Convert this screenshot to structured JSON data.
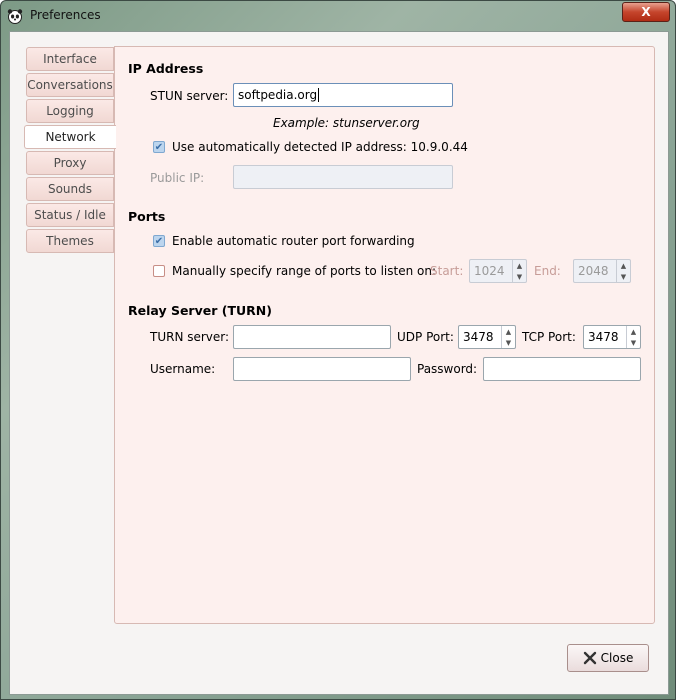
{
  "window": {
    "title": "Preferences",
    "close_glyph": "X"
  },
  "tabs": [
    {
      "label": "Interface"
    },
    {
      "label": "Conversations"
    },
    {
      "label": "Logging"
    },
    {
      "label": "Network",
      "active": true
    },
    {
      "label": "Proxy"
    },
    {
      "label": "Sounds"
    },
    {
      "label": "Status / Idle"
    },
    {
      "label": "Themes"
    }
  ],
  "ip": {
    "heading": "IP Address",
    "stun_label": "STUN server:",
    "stun_value": "softpedia.org",
    "example": "Example: stunserver.org",
    "auto_label": "Use automatically detected IP address: 10.9.0.44",
    "auto_checked": true,
    "public_label": "Public IP:",
    "public_value": ""
  },
  "ports": {
    "heading": "Ports",
    "router_label": "Enable automatic router port forwarding",
    "router_checked": true,
    "manual_label": "Manually specify range of ports to listen on:",
    "manual_checked": false,
    "start_label": "Start:",
    "start_value": "1024",
    "end_label": "End:",
    "end_value": "2048"
  },
  "relay": {
    "heading": "Relay Server (TURN)",
    "turn_label": "TURN server:",
    "turn_value": "",
    "udp_label": "UDP Port:",
    "udp_value": "3478",
    "tcp_label": "TCP Port:",
    "tcp_value": "3478",
    "user_label": "Username:",
    "user_value": "",
    "pass_label": "Password:",
    "pass_value": ""
  },
  "footer": {
    "close_label": "Close"
  },
  "icons": {
    "app": "panda-icon",
    "close": "close-icon"
  },
  "colors": {
    "accent": "#3c6fa8",
    "panel": "#fdf0ee",
    "tab": "#f1d8d3"
  }
}
